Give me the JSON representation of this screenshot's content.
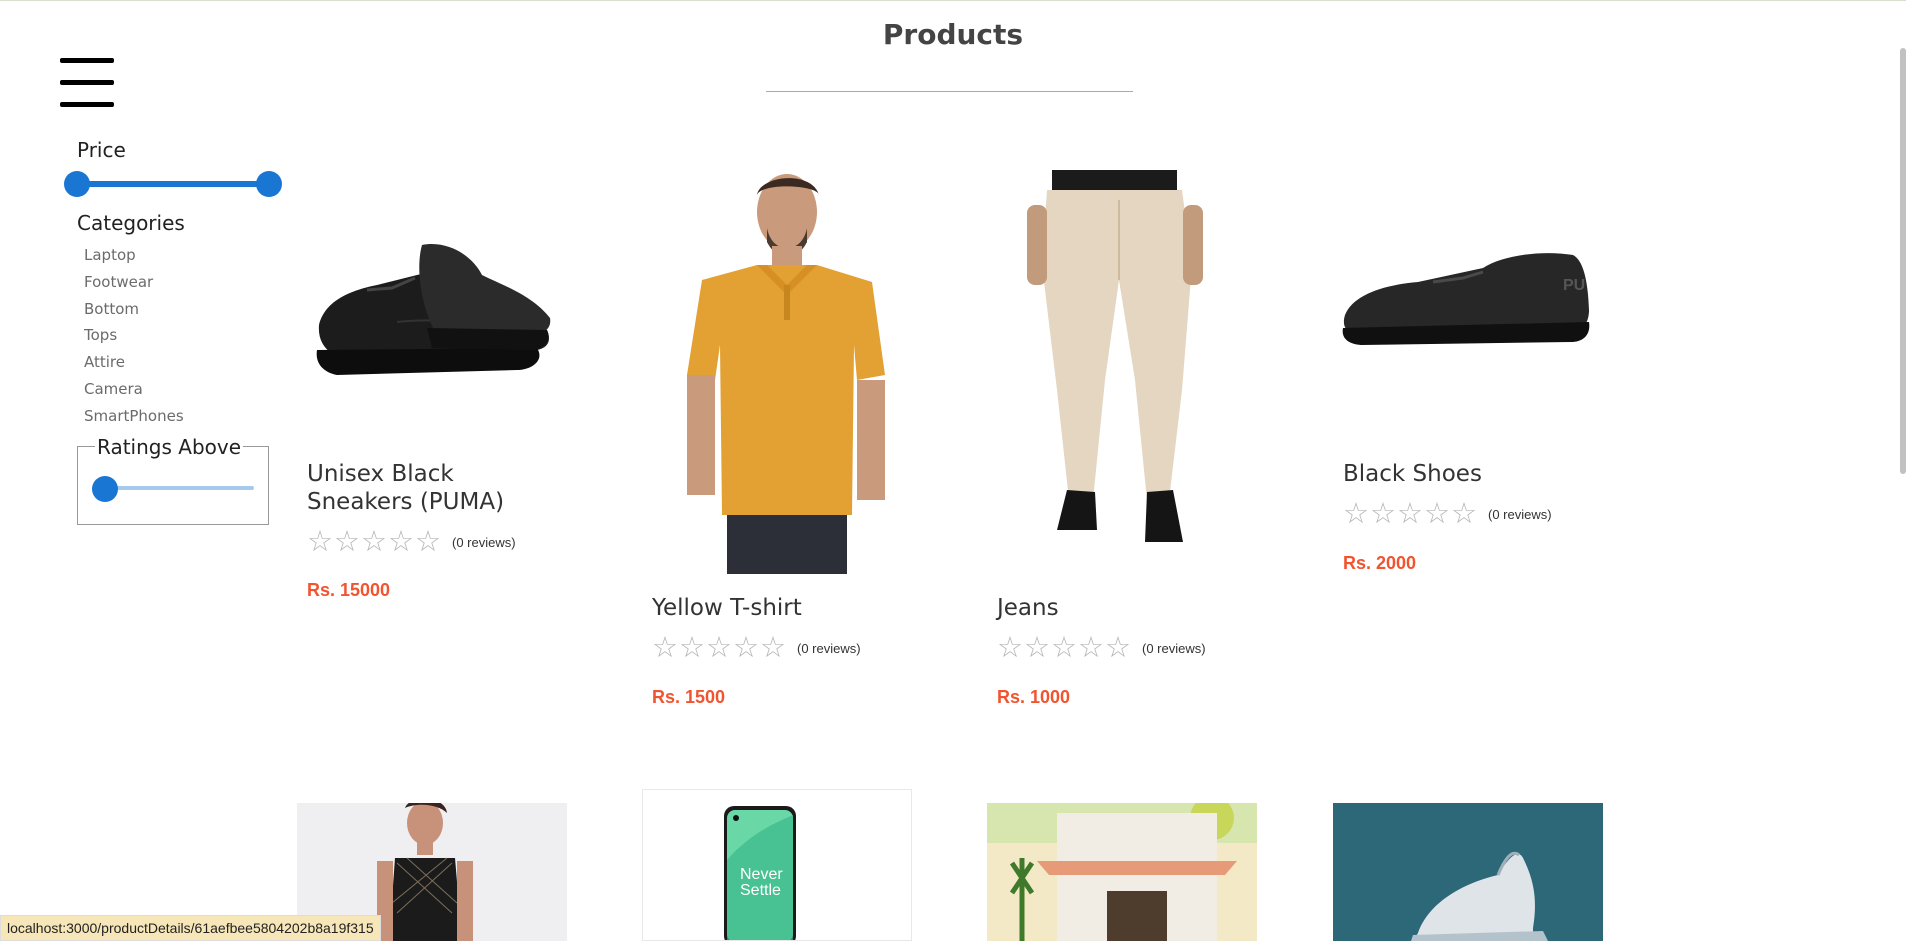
{
  "page": {
    "title": "Products"
  },
  "filters": {
    "price_label": "Price",
    "price_range": [
      0,
      25000
    ],
    "categories_label": "Categories",
    "categories": [
      "Laptop",
      "Footwear",
      "Bottom",
      "Tops",
      "Attire",
      "Camera",
      "SmartPhones"
    ],
    "ratings_label": "Ratings Above",
    "ratings_value": 0
  },
  "products": [
    {
      "name": "Unisex Black Sneakers (PUMA)",
      "reviews": "(0 reviews)",
      "price": "Rs. 15000",
      "rating": 0
    },
    {
      "name": "Yellow T-shirt",
      "reviews": "(0 reviews)",
      "price": "Rs. 1500",
      "rating": 0
    },
    {
      "name": "Jeans",
      "reviews": "(0 reviews)",
      "price": "Rs. 1000",
      "rating": 0
    },
    {
      "name": "Black Shoes",
      "reviews": "(0 reviews)",
      "price": "Rs. 2000",
      "rating": 0
    }
  ],
  "second_row_images": [
    {
      "alt_icon": "dress-photo"
    },
    {
      "alt_icon": "phone-photo",
      "text": "Never Settle"
    },
    {
      "alt_icon": "building-photo"
    },
    {
      "alt_icon": "sneaker-photo"
    }
  ],
  "status_bar": {
    "url": "localhost:3000/productDetails/61aefbee5804202b8a19f315"
  },
  "colors": {
    "accent": "#1976d2",
    "price": "#f2542f",
    "star": "#b7b7b7"
  }
}
